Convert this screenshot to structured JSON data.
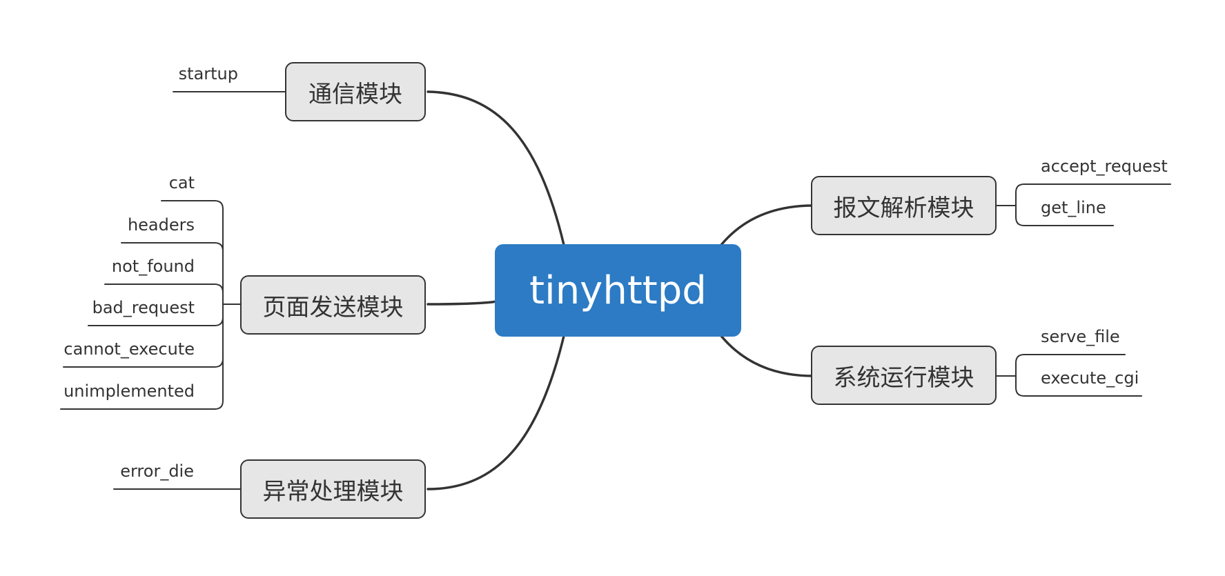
{
  "root": {
    "label": "tinyhttpd",
    "color": "#2c7bc4"
  },
  "branches": [
    {
      "label": "通信模块",
      "children": [
        "startup"
      ]
    },
    {
      "label": "页面发送模块",
      "children": [
        "cat",
        "headers",
        "not_found",
        "bad_request",
        "cannot_execute",
        "unimplemented"
      ]
    },
    {
      "label": "异常处理模块",
      "children": [
        "error_die"
      ]
    },
    {
      "label": "报文解析模块",
      "children": [
        "accept_request",
        "get_line"
      ]
    },
    {
      "label": "系统运行模块",
      "children": [
        "serve_file",
        "execute_cgi"
      ]
    }
  ]
}
